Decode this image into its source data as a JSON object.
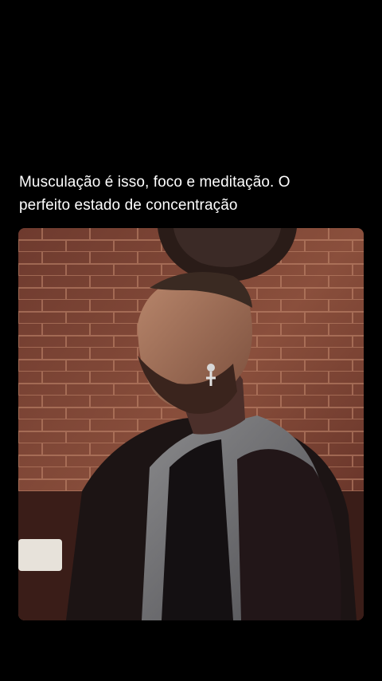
{
  "post": {
    "caption_line1": "Musculação é isso, foco e meditação. O",
    "caption_line2": "perfeito estado de concentração"
  },
  "media": {
    "kind": "video-frame",
    "background_color": "#000000"
  }
}
